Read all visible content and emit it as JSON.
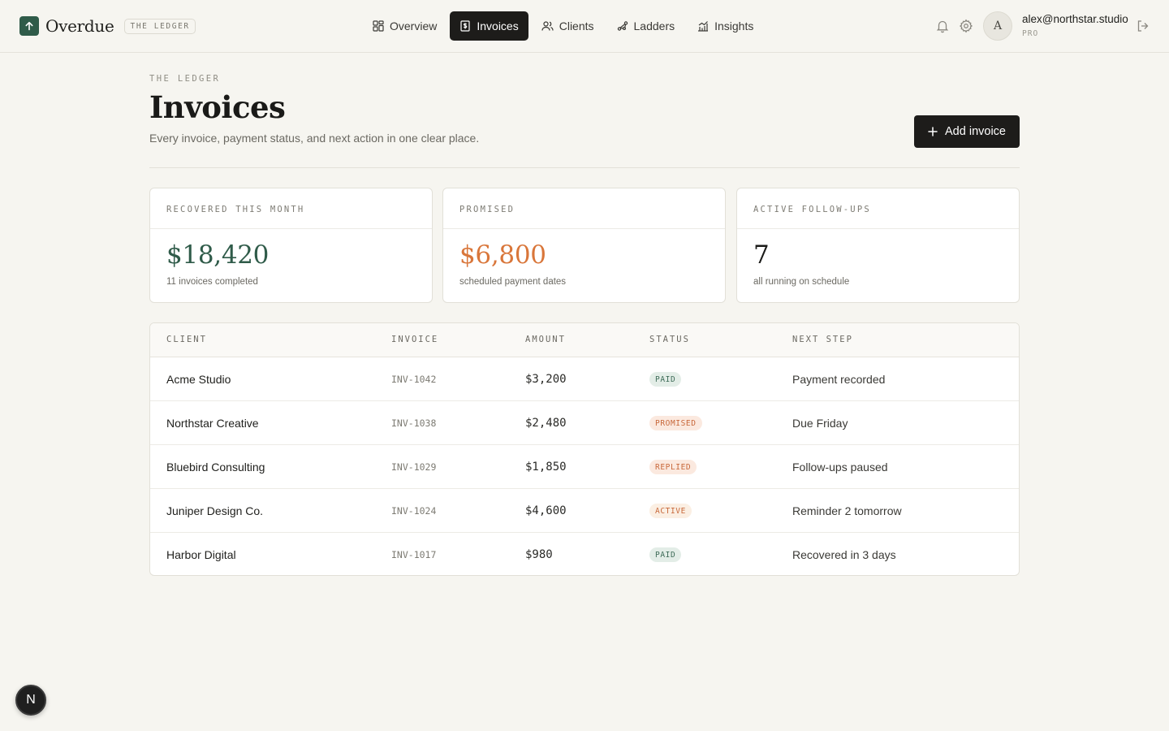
{
  "brand": {
    "name": "Overdue",
    "tag": "THE LEDGER"
  },
  "nav": [
    {
      "label": "Overview",
      "icon": "grid-icon",
      "active": false
    },
    {
      "label": "Invoices",
      "icon": "invoice-icon",
      "active": true
    },
    {
      "label": "Clients",
      "icon": "users-icon",
      "active": false
    },
    {
      "label": "Ladders",
      "icon": "ladder-icon",
      "active": false
    },
    {
      "label": "Insights",
      "icon": "chart-icon",
      "active": false
    }
  ],
  "user": {
    "avatar_letter": "A",
    "email": "alex@northstar.studio",
    "plan": "PRO"
  },
  "page": {
    "eyebrow": "THE LEDGER",
    "title": "Invoices",
    "subtitle": "Every invoice, payment status, and next action in one clear place.",
    "add_label": "Add invoice"
  },
  "stats": [
    {
      "label": "RECOVERED THIS MONTH",
      "value": "$18,420",
      "note": "11 invoices completed",
      "color": "#2f5b49"
    },
    {
      "label": "PROMISED",
      "value": "$6,800",
      "note": "scheduled payment dates",
      "color": "#d9763a"
    },
    {
      "label": "ACTIVE FOLLOW-UPS",
      "value": "7",
      "note": "all running on schedule",
      "color": "#1a1a18"
    }
  ],
  "table": {
    "headers": {
      "client": "CLIENT",
      "invoice": "INVOICE",
      "amount": "AMOUNT",
      "status": "STATUS",
      "next": "NEXT STEP"
    },
    "rows": [
      {
        "client": "Acme Studio",
        "invoice": "INV-1042",
        "amount": "$3,200",
        "status": "PAID",
        "next": "Payment recorded"
      },
      {
        "client": "Northstar Creative",
        "invoice": "INV-1038",
        "amount": "$2,480",
        "status": "PROMISED",
        "next": "Due Friday"
      },
      {
        "client": "Bluebird Consulting",
        "invoice": "INV-1029",
        "amount": "$1,850",
        "status": "REPLIED",
        "next": "Follow-ups paused"
      },
      {
        "client": "Juniper Design Co.",
        "invoice": "INV-1024",
        "amount": "$4,600",
        "status": "ACTIVE",
        "next": "Reminder 2 tomorrow"
      },
      {
        "client": "Harbor Digital",
        "invoice": "INV-1017",
        "amount": "$980",
        "status": "PAID",
        "next": "Recovered in 3 days"
      }
    ]
  },
  "status_colors": {
    "PAID": {
      "bg": "#e3ede7",
      "fg": "#3d6b57"
    },
    "PROMISED": {
      "bg": "#fbe9df",
      "fg": "#c8683a"
    },
    "REPLIED": {
      "bg": "#fbe9df",
      "fg": "#c8683a"
    },
    "ACTIVE": {
      "bg": "#fbefe3",
      "fg": "#c8683a"
    }
  },
  "fab_label": "N"
}
